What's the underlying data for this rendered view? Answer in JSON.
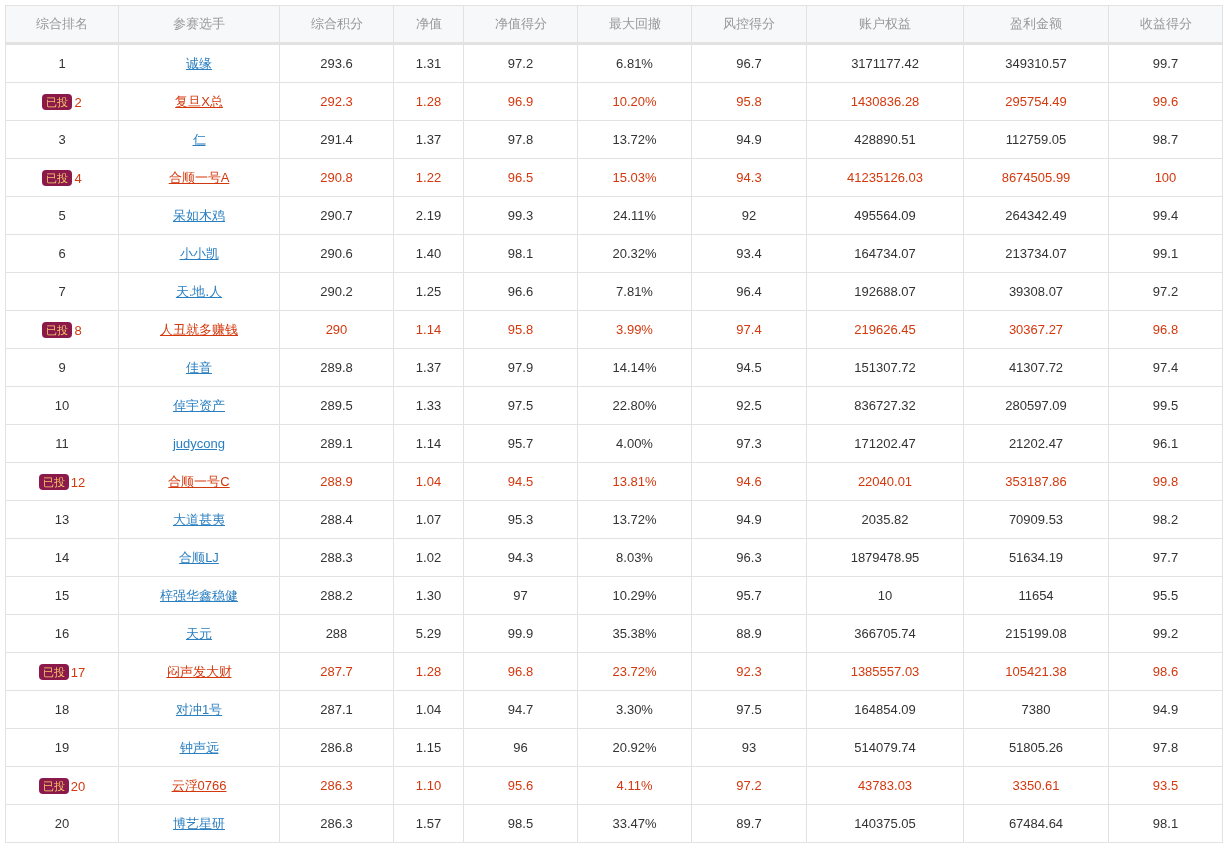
{
  "table": {
    "columns": [
      "综合排名",
      "参赛选手",
      "综合积分",
      "净值",
      "净值得分",
      "最大回撤",
      "风控得分",
      "账户权益",
      "盈利金额",
      "收益得分"
    ],
    "rows": [
      {
        "invested": false,
        "cells": [
          "1",
          "诚缘",
          "293.6",
          "1.31",
          "97.2",
          "6.81%",
          "96.7",
          "3171177.42",
          "349310.57",
          "99.7"
        ]
      },
      {
        "invested": true,
        "badge": "已投",
        "cells": [
          "2",
          "复旦X总",
          "292.3",
          "1.28",
          "96.9",
          "10.20%",
          "95.8",
          "1430836.28",
          "295754.49",
          "99.6"
        ]
      },
      {
        "invested": false,
        "cells": [
          "3",
          "仁",
          "291.4",
          "1.37",
          "97.8",
          "13.72%",
          "94.9",
          "428890.51",
          "112759.05",
          "98.7"
        ]
      },
      {
        "invested": true,
        "badge": "已投",
        "cells": [
          "4",
          "合顺一号A",
          "290.8",
          "1.22",
          "96.5",
          "15.03%",
          "94.3",
          "41235126.03",
          "8674505.99",
          "100"
        ]
      },
      {
        "invested": false,
        "cells": [
          "5",
          "呆如木鸡",
          "290.7",
          "2.19",
          "99.3",
          "24.11%",
          "92",
          "495564.09",
          "264342.49",
          "99.4"
        ]
      },
      {
        "invested": false,
        "cells": [
          "6",
          "小小凯",
          "290.6",
          "1.40",
          "98.1",
          "20.32%",
          "93.4",
          "164734.07",
          "213734.07",
          "99.1"
        ]
      },
      {
        "invested": false,
        "cells": [
          "7",
          "天.地.人",
          "290.2",
          "1.25",
          "96.6",
          "7.81%",
          "96.4",
          "192688.07",
          "39308.07",
          "97.2"
        ]
      },
      {
        "invested": true,
        "badge": "已投",
        "cells": [
          "8",
          "人丑就多赚钱",
          "290",
          "1.14",
          "95.8",
          "3.99%",
          "97.4",
          "219626.45",
          "30367.27",
          "96.8"
        ]
      },
      {
        "invested": false,
        "cells": [
          "9",
          "佳音",
          "289.8",
          "1.37",
          "97.9",
          "14.14%",
          "94.5",
          "151307.72",
          "41307.72",
          "97.4"
        ]
      },
      {
        "invested": false,
        "cells": [
          "10",
          "倬宇资产",
          "289.5",
          "1.33",
          "97.5",
          "22.80%",
          "92.5",
          "836727.32",
          "280597.09",
          "99.5"
        ]
      },
      {
        "invested": false,
        "cells": [
          "11",
          "judycong",
          "289.1",
          "1.14",
          "95.7",
          "4.00%",
          "97.3",
          "171202.47",
          "21202.47",
          "96.1"
        ]
      },
      {
        "invested": true,
        "badge": "已投",
        "cells": [
          "12",
          "合顺一号C",
          "288.9",
          "1.04",
          "94.5",
          "13.81%",
          "94.6",
          "22040.01",
          "353187.86",
          "99.8"
        ]
      },
      {
        "invested": false,
        "cells": [
          "13",
          "大道甚夷",
          "288.4",
          "1.07",
          "95.3",
          "13.72%",
          "94.9",
          "2035.82",
          "70909.53",
          "98.2"
        ]
      },
      {
        "invested": false,
        "cells": [
          "14",
          "合顺LJ",
          "288.3",
          "1.02",
          "94.3",
          "8.03%",
          "96.3",
          "1879478.95",
          "51634.19",
          "97.7"
        ]
      },
      {
        "invested": false,
        "cells": [
          "15",
          "梓强华鑫稳健",
          "288.2",
          "1.30",
          "97",
          "10.29%",
          "95.7",
          "10",
          "11654",
          "95.5"
        ]
      },
      {
        "invested": false,
        "cells": [
          "16",
          "天元",
          "288",
          "5.29",
          "99.9",
          "35.38%",
          "88.9",
          "366705.74",
          "215199.08",
          "99.2"
        ]
      },
      {
        "invested": true,
        "badge": "已投",
        "cells": [
          "17",
          "闷声发大财",
          "287.7",
          "1.28",
          "96.8",
          "23.72%",
          "92.3",
          "1385557.03",
          "105421.38",
          "98.6"
        ]
      },
      {
        "invested": false,
        "cells": [
          "18",
          "对冲1号",
          "287.1",
          "1.04",
          "94.7",
          "3.30%",
          "97.5",
          "164854.09",
          "7380",
          "94.9"
        ]
      },
      {
        "invested": false,
        "cells": [
          "19",
          "钟声远",
          "286.8",
          "1.15",
          "96",
          "20.92%",
          "93",
          "514079.74",
          "51805.26",
          "97.8"
        ]
      },
      {
        "invested": true,
        "badge": "已投",
        "cells": [
          "20",
          "云浮0766",
          "286.3",
          "1.10",
          "95.6",
          "4.11%",
          "97.2",
          "43783.03",
          "3350.61",
          "93.5"
        ]
      },
      {
        "invested": false,
        "cells": [
          "20",
          "博艺星研",
          "286.3",
          "1.57",
          "98.5",
          "33.47%",
          "89.7",
          "140375.05",
          "67484.64",
          "98.1"
        ]
      }
    ]
  }
}
